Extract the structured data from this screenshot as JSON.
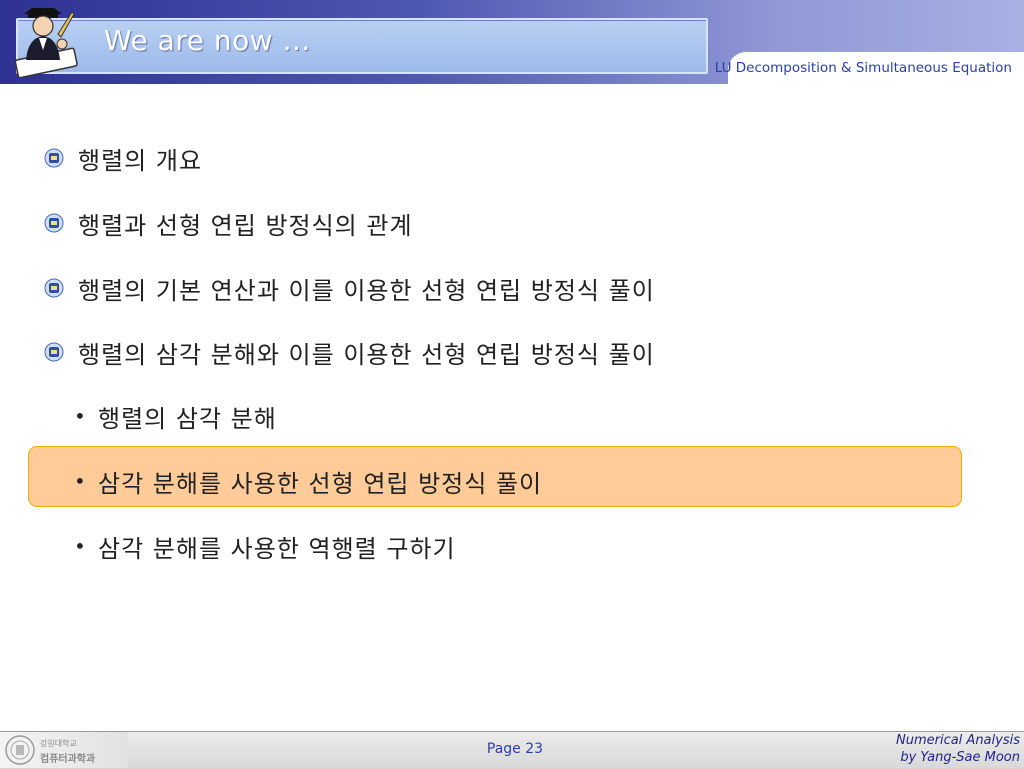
{
  "header": {
    "title": "We are now …",
    "subtitle": "LU Decomposition & Simultaneous Equation"
  },
  "bullets": [
    {
      "text": "행렬의 개요",
      "icon": "crest-bullet-icon"
    },
    {
      "text": "행렬과 선형 연립 방정식의 관계",
      "icon": "crest-bullet-icon"
    },
    {
      "text": "행렬의 기본 연산과 이를 이용한 선형 연립 방정식 풀이",
      "icon": "crest-bullet-icon"
    },
    {
      "text": "행렬의 삼각 분해와 이를 이용한 선형 연립 방정식 풀이",
      "icon": "crest-bullet-icon"
    }
  ],
  "sub_bullets": [
    {
      "text": "행렬의 삼각 분해",
      "highlighted": false
    },
    {
      "text": "삼각 분해를 사용한 선형 연립 방정식 풀이",
      "highlighted": true
    },
    {
      "text": "삼각 분해를 사용한 역행렬 구하기",
      "highlighted": false
    }
  ],
  "footer": {
    "university_line1": "강원대학교",
    "university_line2": "컴퓨터과학과",
    "page": "Page 23",
    "credit_line1": "Numerical Analysis",
    "credit_line2": "by Yang-Sae Moon"
  },
  "colors": {
    "header_dark": "#2e3192",
    "title_bar": "#a9c4ee",
    "subtitle_text": "#2a3fa8",
    "highlight_fill": "#ffcc99",
    "highlight_border": "#e8b000",
    "footer_text": "#23238e"
  }
}
